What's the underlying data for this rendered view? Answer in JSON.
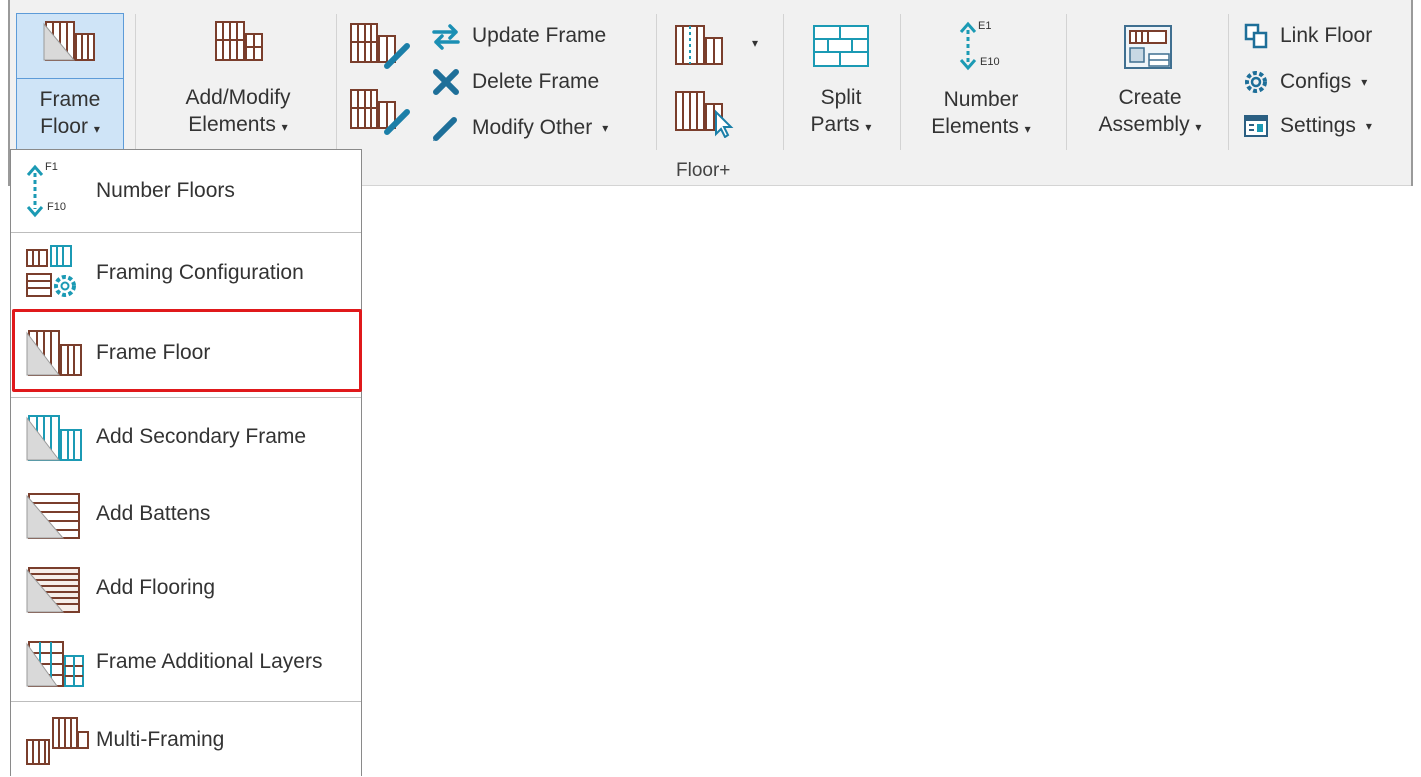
{
  "ribbon": {
    "frame_floor": {
      "line1": "Frame",
      "line2": "Floor"
    },
    "add_modify": {
      "line1": "Add/Modify",
      "line2": "Elements"
    },
    "update_frame": "Update Frame",
    "delete_frame": "Delete Frame",
    "modify_other": "Modify Other",
    "split_parts": {
      "line1": "Split",
      "line2": "Parts"
    },
    "number_elements": {
      "line1": "Number",
      "line2": "Elements",
      "icon_top": "E1",
      "icon_bottom": "E10"
    },
    "create_assembly": {
      "line1": "Create",
      "line2": "Assembly"
    },
    "link_floor": "Link Floor",
    "configs": "Configs",
    "settings": "Settings",
    "group_label": "Floor+"
  },
  "menu": {
    "items": [
      {
        "label": "Number Floors",
        "icon": "number-floors-icon",
        "icon_top": "F1",
        "icon_bottom": "F10"
      },
      {
        "label": "Framing Configuration",
        "icon": "framing-configuration-icon"
      },
      {
        "label": "Frame Floor",
        "icon": "frame-floor-icon",
        "highlighted": true
      },
      {
        "label": "Add Secondary Frame",
        "icon": "secondary-frame-icon"
      },
      {
        "label": "Add Battens",
        "icon": "battens-icon"
      },
      {
        "label": "Add Flooring",
        "icon": "flooring-icon"
      },
      {
        "label": "Frame Additional Layers",
        "icon": "additional-layers-icon"
      },
      {
        "label": "Multi-Framing",
        "icon": "multi-framing-icon"
      }
    ]
  },
  "colors": {
    "brown": "#8b4a36",
    "teal": "#1b9ab4",
    "highlight": "#e0191b",
    "active_bg": "#cfe4f7"
  }
}
